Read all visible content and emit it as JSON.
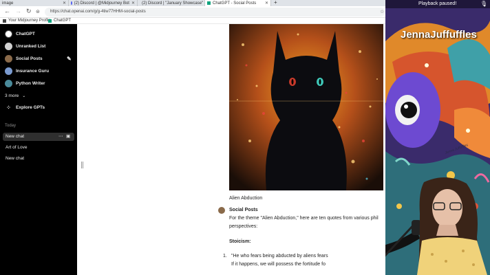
{
  "browser": {
    "tabs": [
      {
        "label": "image"
      },
      {
        "label": "(2) Discord | @Midjourney Bot"
      },
      {
        "label": "(2) Discord | \"January Showcase\""
      },
      {
        "label": "ChatGPT - Social Posts"
      }
    ],
    "new_tab": "+",
    "url": "https://chat.openai.com/g/g-4tiw77HHM-social-posts",
    "bookmarks": [
      {
        "label": "Your Midjourney Profile"
      },
      {
        "label": "ChatGPT"
      }
    ]
  },
  "sidebar": {
    "gpts": [
      {
        "label": "ChatGPT",
        "color": "#ffffff"
      },
      {
        "label": "Unranked List",
        "color": "#cfcfcf"
      },
      {
        "label": "Social Posts",
        "color": "#8a6a4a"
      },
      {
        "label": "Insurance Guru",
        "color": "#7a9acf"
      },
      {
        "label": "Python Writer",
        "color": "#4a8a9a"
      }
    ],
    "more_label": "3 more",
    "explore_label": "Explore GPTs",
    "section_today": "Today",
    "chats": [
      {
        "label": "New chat"
      },
      {
        "label": "Art of Love"
      },
      {
        "label": "New chat"
      }
    ]
  },
  "conversation": {
    "image_caption": "Alien Abduction",
    "assistant_name": "Social Posts",
    "reply_line1": "For the theme \"Alien Abduction,\" here are ten quotes from various phil",
    "reply_line2": "perspectives:",
    "section_heading": "Stoicism:",
    "item_number": "1.",
    "item_line1": "\"He who fears being abducted by aliens fears",
    "item_line2": "If it happens, we will possess the fortitude fo"
  },
  "stream": {
    "status": "Playback paused!",
    "streamer_name": "JennaJuffuffles",
    "signature": "Jenna Juffuffles"
  },
  "colors": {
    "sidebar_bg": "#000000",
    "accent": "#10a37f"
  }
}
